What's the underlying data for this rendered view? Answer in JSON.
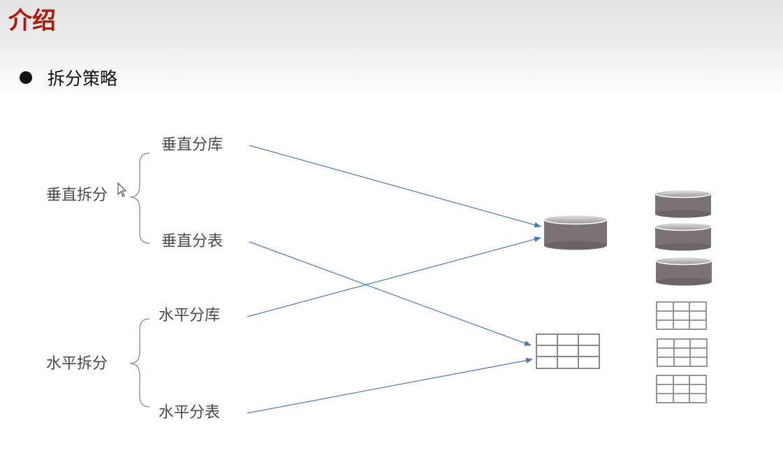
{
  "slide": {
    "title": "介绍",
    "bullet": "拆分策略"
  },
  "diagram": {
    "groups": [
      {
        "label": "垂直拆分",
        "items": [
          "垂直分库",
          "垂直分表"
        ]
      },
      {
        "label": "水平拆分",
        "items": [
          "水平分库",
          "水平分表"
        ]
      }
    ],
    "targets": {
      "database": "database-icon",
      "table": "table-icon"
    },
    "arrows": [
      {
        "from": "垂直分库",
        "to": "database-icon"
      },
      {
        "from": "垂直分表",
        "to": "table-icon"
      },
      {
        "from": "水平分库",
        "to": "database-icon"
      },
      {
        "from": "水平分表",
        "to": "table-icon"
      }
    ],
    "split_result_icons": [
      "database-icon",
      "database-icon",
      "database-icon",
      "table-icon",
      "table-icon",
      "table-icon"
    ]
  },
  "colors": {
    "title": "#b01a0e",
    "arrow": "#4a7ab8",
    "database": "#7a7275",
    "table_stroke": "#8a8a8a"
  }
}
